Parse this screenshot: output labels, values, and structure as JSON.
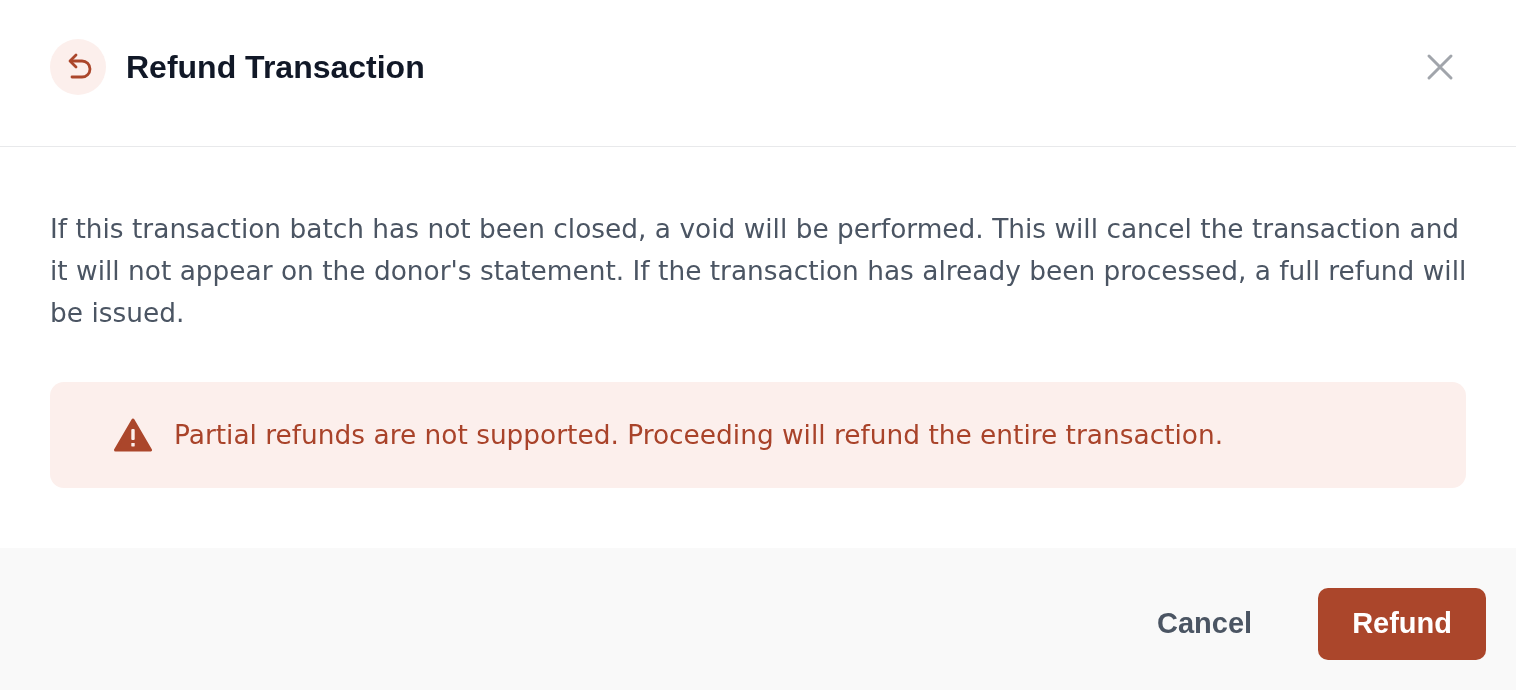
{
  "dialog": {
    "title": "Refund Transaction",
    "message": "If this transaction batch has not been closed, a void will be performed. This will cancel the transaction and it will not appear on the donor's statement. If the transaction has already been processed, a full refund will be issued.",
    "warning": "Partial refunds are not supported. Proceeding will refund the entire transaction.",
    "buttons": [
      {
        "label": "Cancel",
        "kind": "secondary"
      },
      {
        "label": "Refund",
        "kind": "primary"
      }
    ]
  }
}
